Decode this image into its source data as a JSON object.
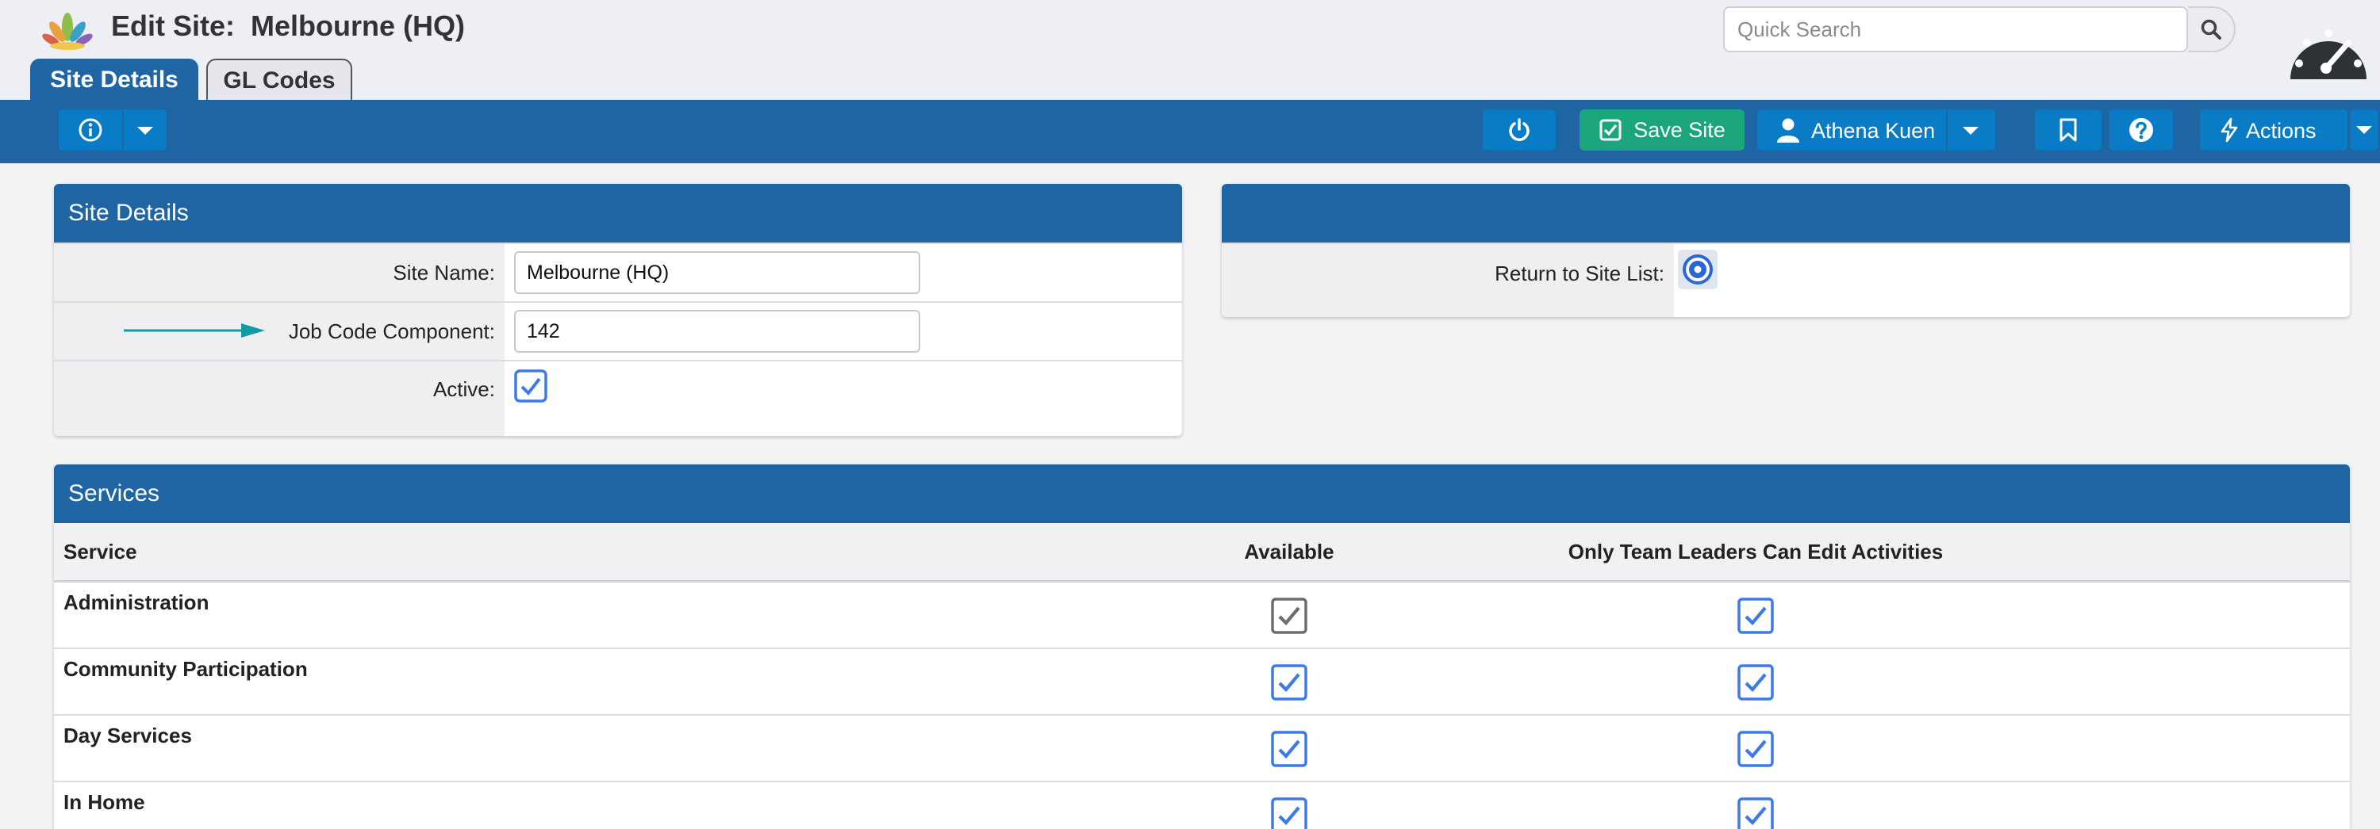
{
  "header": {
    "title_prefix": "Edit Site:",
    "title_site": "Melbourne (HQ)",
    "search": {
      "placeholder": "Quick Search",
      "value": ""
    },
    "logo": "lotus-logo-icon",
    "dashboard_icon": "speedometer-icon"
  },
  "tabs": [
    {
      "label": "Site Details",
      "active": true
    },
    {
      "label": "GL Codes",
      "active": false
    }
  ],
  "toolbar": {
    "info_icon": "info-circle-icon",
    "power_icon": "power-icon",
    "save_label": "Save Site",
    "user_name": "Athena Kuen",
    "bookmark_icon": "bookmark-icon",
    "help_icon": "question-circle-icon",
    "actions_label": "Actions"
  },
  "site_details": {
    "heading": "Site Details",
    "fields": {
      "site_name": {
        "label": "Site Name:",
        "value": "Melbourne (HQ)"
      },
      "job_code": {
        "label": "Job Code Component:",
        "value": "142"
      },
      "active": {
        "label": "Active:",
        "checked": true
      }
    }
  },
  "side_panel": {
    "heading": "",
    "return_label": "Return to Site List:",
    "return_icon": "target-circle-icon"
  },
  "services": {
    "heading": "Services",
    "columns": [
      "Service",
      "Available",
      "Only Team Leaders Can Edit Activities"
    ],
    "rows": [
      {
        "name": "Administration",
        "available": true,
        "available_disabled": true,
        "team_leaders_only": true
      },
      {
        "name": "Community Participation",
        "available": true,
        "available_disabled": false,
        "team_leaders_only": true
      },
      {
        "name": "Day Services",
        "available": true,
        "available_disabled": false,
        "team_leaders_only": true
      },
      {
        "name": "In Home",
        "available": true,
        "available_disabled": false,
        "team_leaders_only": true
      }
    ]
  },
  "colors": {
    "brand_blue": "#2065a3",
    "button_blue": "#0a7cc6",
    "save_green": "#1ba57d",
    "checkbox_blue": "#3d7ae8",
    "checkbox_grey": "#6d6d6d",
    "arrow_teal": "#139aa3"
  }
}
